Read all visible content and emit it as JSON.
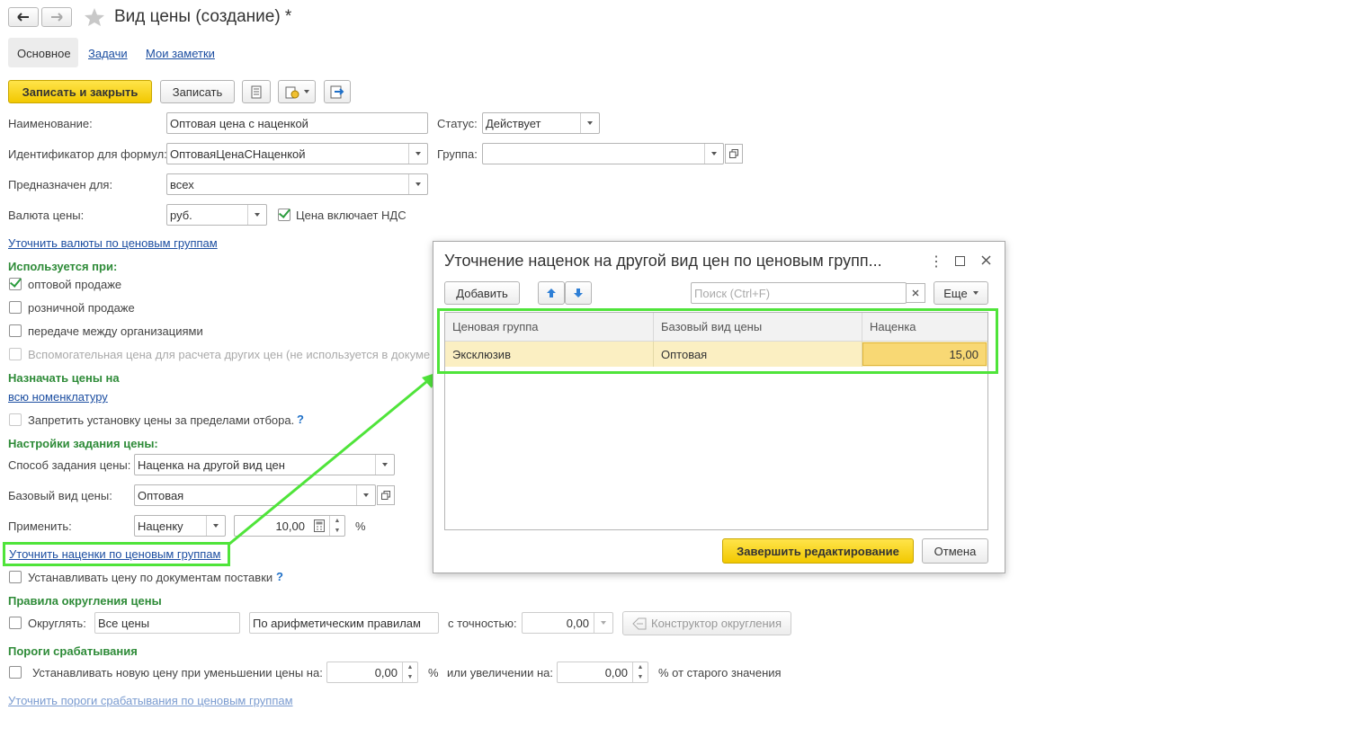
{
  "window": {
    "title": "Вид цены (создание) *"
  },
  "tabs": [
    {
      "label": "Основное"
    },
    {
      "label": "Задачи"
    },
    {
      "label": "Мои заметки"
    }
  ],
  "toolbar": {
    "save_close": "Записать и закрыть",
    "save": "Записать"
  },
  "form": {
    "name_label": "Наименование:",
    "name_value": "Оптовая цена с наценкой",
    "status_label": "Статус:",
    "status_value": "Действует",
    "id_label": "Идентификатор для формул:",
    "id_value": "ОптоваяЦенаСНаценкой",
    "group_label": "Группа:",
    "group_value": "",
    "for_label": "Предназначен для:",
    "for_value": "всех",
    "currency_label": "Валюта цены:",
    "currency_value": "руб.",
    "vat_label": "Цена включает НДС",
    "vat_checked": true,
    "currency_link": "Уточнить валюты по ценовым группам",
    "used_header": "Используется при:",
    "used": [
      {
        "label": "оптовой продаже",
        "checked": true,
        "disabled": false
      },
      {
        "label": "розничной продаже",
        "checked": false,
        "disabled": false
      },
      {
        "label": "передаче между организациями",
        "checked": false,
        "disabled": false
      },
      {
        "label": "Вспомогательная цена для расчета других цен (не используется в докуме",
        "checked": false,
        "disabled": true
      }
    ],
    "assign_header": "Назначать цены на",
    "assign_link": "всю номенклатуру",
    "forbid_label": "Запретить установку цены за пределами отбора.",
    "settings_header": "Настройки задания цены:",
    "method_label": "Способ задания цены:",
    "method_value": "Наценка на другой вид цен",
    "base_label": "Базовый вид цены:",
    "base_value": "Оптовая",
    "apply_label": "Применить:",
    "apply_value": "Наценку",
    "apply_number": "10,00",
    "apply_unit": "%",
    "markup_link": "Уточнить наценки по ценовым группам",
    "supply_label": "Устанавливать цену по документам поставки",
    "round_header": "Правила округления цены",
    "round_label": "Округлять:",
    "round_all": "Все цены",
    "round_rule": "По арифметическим правилам",
    "precision_label": "с точностью:",
    "precision_value": "0,00",
    "round_constructor": "Конструктор округления",
    "threshold_header": "Пороги срабатывания",
    "threshold_label": "Устанавливать новую цену при уменьшении цены на:",
    "threshold_dec": "0,00",
    "threshold_pct1": "%",
    "threshold_inc_label": "или увеличении на:",
    "threshold_inc": "0,00",
    "threshold_suffix": "% от старого значения",
    "threshold_link": "Уточнить пороги срабатывания по ценовым группам"
  },
  "dialog": {
    "title": "Уточнение наценок на другой вид цен по ценовым групп...",
    "add": "Добавить",
    "search_placeholder": "Поиск (Ctrl+F)",
    "more": "Еще",
    "columns": [
      "Ценовая группа",
      "Базовый вид цены",
      "Наценка"
    ],
    "rows": [
      {
        "group": "Эксклюзив",
        "base": "Оптовая",
        "markup": "15,00"
      }
    ],
    "finish": "Завершить редактирование",
    "cancel": "Отмена"
  }
}
